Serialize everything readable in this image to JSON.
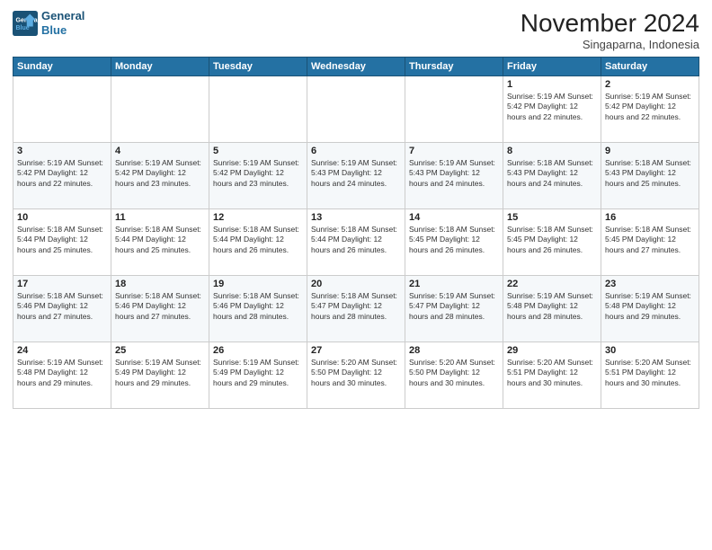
{
  "logo": {
    "line1": "General",
    "line2": "Blue"
  },
  "title": "November 2024",
  "subtitle": "Singaparna, Indonesia",
  "days_of_week": [
    "Sunday",
    "Monday",
    "Tuesday",
    "Wednesday",
    "Thursday",
    "Friday",
    "Saturday"
  ],
  "weeks": [
    [
      {
        "day": "",
        "info": ""
      },
      {
        "day": "",
        "info": ""
      },
      {
        "day": "",
        "info": ""
      },
      {
        "day": "",
        "info": ""
      },
      {
        "day": "",
        "info": ""
      },
      {
        "day": "1",
        "info": "Sunrise: 5:19 AM\nSunset: 5:42 PM\nDaylight: 12 hours\nand 22 minutes."
      },
      {
        "day": "2",
        "info": "Sunrise: 5:19 AM\nSunset: 5:42 PM\nDaylight: 12 hours\nand 22 minutes."
      }
    ],
    [
      {
        "day": "3",
        "info": "Sunrise: 5:19 AM\nSunset: 5:42 PM\nDaylight: 12 hours\nand 22 minutes."
      },
      {
        "day": "4",
        "info": "Sunrise: 5:19 AM\nSunset: 5:42 PM\nDaylight: 12 hours\nand 23 minutes."
      },
      {
        "day": "5",
        "info": "Sunrise: 5:19 AM\nSunset: 5:42 PM\nDaylight: 12 hours\nand 23 minutes."
      },
      {
        "day": "6",
        "info": "Sunrise: 5:19 AM\nSunset: 5:43 PM\nDaylight: 12 hours\nand 24 minutes."
      },
      {
        "day": "7",
        "info": "Sunrise: 5:19 AM\nSunset: 5:43 PM\nDaylight: 12 hours\nand 24 minutes."
      },
      {
        "day": "8",
        "info": "Sunrise: 5:18 AM\nSunset: 5:43 PM\nDaylight: 12 hours\nand 24 minutes."
      },
      {
        "day": "9",
        "info": "Sunrise: 5:18 AM\nSunset: 5:43 PM\nDaylight: 12 hours\nand 25 minutes."
      }
    ],
    [
      {
        "day": "10",
        "info": "Sunrise: 5:18 AM\nSunset: 5:44 PM\nDaylight: 12 hours\nand 25 minutes."
      },
      {
        "day": "11",
        "info": "Sunrise: 5:18 AM\nSunset: 5:44 PM\nDaylight: 12 hours\nand 25 minutes."
      },
      {
        "day": "12",
        "info": "Sunrise: 5:18 AM\nSunset: 5:44 PM\nDaylight: 12 hours\nand 26 minutes."
      },
      {
        "day": "13",
        "info": "Sunrise: 5:18 AM\nSunset: 5:44 PM\nDaylight: 12 hours\nand 26 minutes."
      },
      {
        "day": "14",
        "info": "Sunrise: 5:18 AM\nSunset: 5:45 PM\nDaylight: 12 hours\nand 26 minutes."
      },
      {
        "day": "15",
        "info": "Sunrise: 5:18 AM\nSunset: 5:45 PM\nDaylight: 12 hours\nand 26 minutes."
      },
      {
        "day": "16",
        "info": "Sunrise: 5:18 AM\nSunset: 5:45 PM\nDaylight: 12 hours\nand 27 minutes."
      }
    ],
    [
      {
        "day": "17",
        "info": "Sunrise: 5:18 AM\nSunset: 5:46 PM\nDaylight: 12 hours\nand 27 minutes."
      },
      {
        "day": "18",
        "info": "Sunrise: 5:18 AM\nSunset: 5:46 PM\nDaylight: 12 hours\nand 27 minutes."
      },
      {
        "day": "19",
        "info": "Sunrise: 5:18 AM\nSunset: 5:46 PM\nDaylight: 12 hours\nand 28 minutes."
      },
      {
        "day": "20",
        "info": "Sunrise: 5:18 AM\nSunset: 5:47 PM\nDaylight: 12 hours\nand 28 minutes."
      },
      {
        "day": "21",
        "info": "Sunrise: 5:19 AM\nSunset: 5:47 PM\nDaylight: 12 hours\nand 28 minutes."
      },
      {
        "day": "22",
        "info": "Sunrise: 5:19 AM\nSunset: 5:48 PM\nDaylight: 12 hours\nand 28 minutes."
      },
      {
        "day": "23",
        "info": "Sunrise: 5:19 AM\nSunset: 5:48 PM\nDaylight: 12 hours\nand 29 minutes."
      }
    ],
    [
      {
        "day": "24",
        "info": "Sunrise: 5:19 AM\nSunset: 5:48 PM\nDaylight: 12 hours\nand 29 minutes."
      },
      {
        "day": "25",
        "info": "Sunrise: 5:19 AM\nSunset: 5:49 PM\nDaylight: 12 hours\nand 29 minutes."
      },
      {
        "day": "26",
        "info": "Sunrise: 5:19 AM\nSunset: 5:49 PM\nDaylight: 12 hours\nand 29 minutes."
      },
      {
        "day": "27",
        "info": "Sunrise: 5:20 AM\nSunset: 5:50 PM\nDaylight: 12 hours\nand 30 minutes."
      },
      {
        "day": "28",
        "info": "Sunrise: 5:20 AM\nSunset: 5:50 PM\nDaylight: 12 hours\nand 30 minutes."
      },
      {
        "day": "29",
        "info": "Sunrise: 5:20 AM\nSunset: 5:51 PM\nDaylight: 12 hours\nand 30 minutes."
      },
      {
        "day": "30",
        "info": "Sunrise: 5:20 AM\nSunset: 5:51 PM\nDaylight: 12 hours\nand 30 minutes."
      }
    ]
  ]
}
